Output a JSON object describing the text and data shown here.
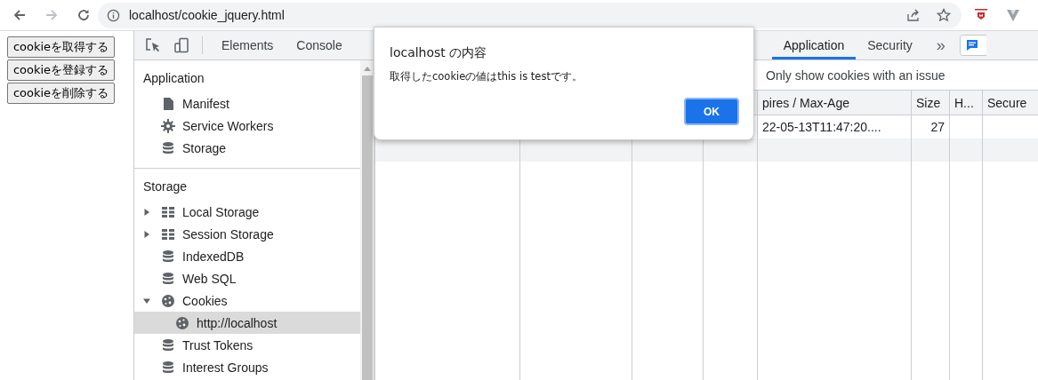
{
  "browser": {
    "url": "localhost/cookie_jquery.html",
    "forward_disabled": true
  },
  "page_buttons": [
    "cookieを取得する",
    "cookieを登録する",
    "cookieを削除する"
  ],
  "devtools": {
    "tabs": [
      {
        "label": "Elements",
        "selected": false
      },
      {
        "label": "Console",
        "selected": false
      },
      {
        "label": "Application",
        "selected": true
      },
      {
        "label": "Security",
        "selected": false
      }
    ],
    "overflow": "»",
    "sidebar": {
      "sections": [
        {
          "title": "Application",
          "items": [
            {
              "label": "Manifest",
              "kind": "file",
              "selected": false
            },
            {
              "label": "Service Workers",
              "kind": "gear",
              "selected": false
            },
            {
              "label": "Storage",
              "kind": "database",
              "selected": false
            }
          ]
        },
        {
          "title": "Storage",
          "items": [
            {
              "label": "Local Storage",
              "kind": "grid",
              "expanded": false,
              "selected": false
            },
            {
              "label": "Session Storage",
              "kind": "grid",
              "expanded": false,
              "selected": false
            },
            {
              "label": "IndexedDB",
              "kind": "database",
              "selected": false
            },
            {
              "label": "Web SQL",
              "kind": "database",
              "selected": false
            },
            {
              "label": "Cookies",
              "kind": "cookie",
              "expanded": true,
              "selected": false,
              "children": [
                {
                  "label": "http://localhost",
                  "kind": "cookie",
                  "selected": true
                }
              ]
            },
            {
              "label": "Trust Tokens",
              "kind": "database",
              "selected": false
            },
            {
              "label": "Interest Groups",
              "kind": "database",
              "selected": false
            }
          ]
        }
      ]
    },
    "filter": "Only show cookies with an issue",
    "table": {
      "columns": [
        null,
        null,
        null,
        null,
        "pires / Max-Age",
        "Size",
        "H...",
        "Secure"
      ],
      "rows": [
        {
          "cells": [
            null,
            null,
            null,
            null,
            "22-05-13T11:47:20....",
            "27",
            null,
            null
          ]
        }
      ]
    }
  },
  "dialog": {
    "title": "localhost の内容",
    "message": "取得したcookieの値はthis is testです。",
    "button": "OK"
  }
}
